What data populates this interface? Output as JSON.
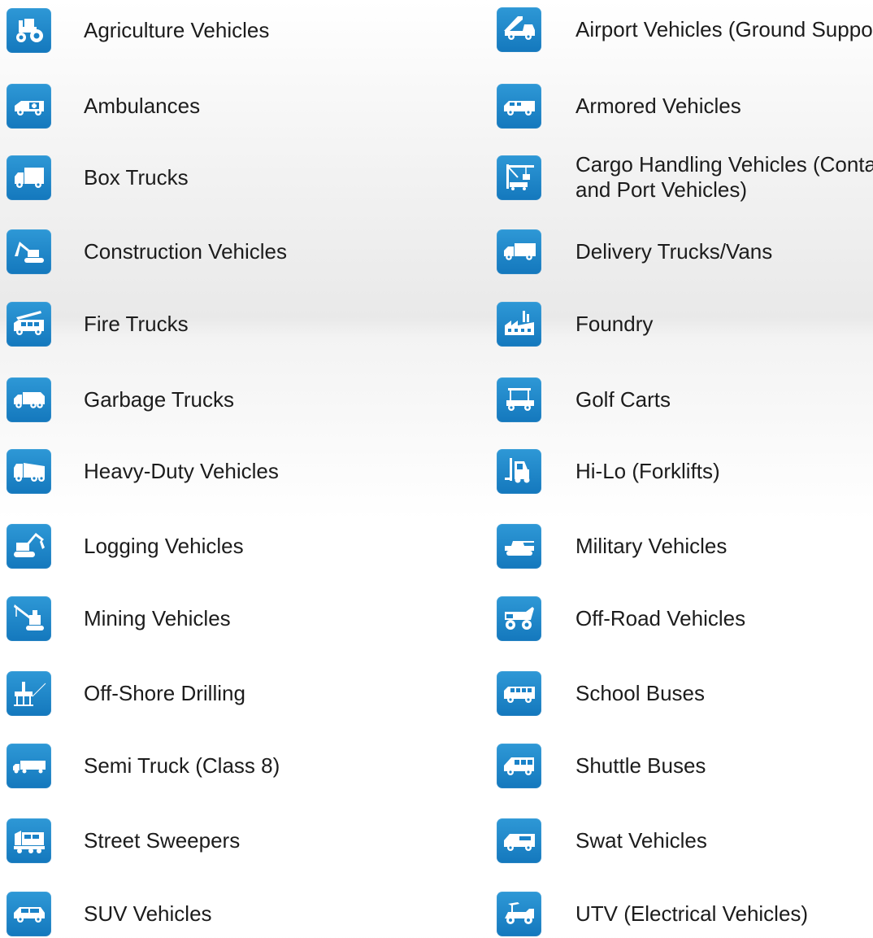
{
  "left": [
    {
      "label": "Agriculture Vehicles",
      "icon": "tractor-icon"
    },
    {
      "label": "Ambulances",
      "icon": "ambulance-icon"
    },
    {
      "label": "Box Trucks",
      "icon": "box-truck-icon"
    },
    {
      "label": "Construction Vehicles",
      "icon": "excavator-icon"
    },
    {
      "label": "Fire Trucks",
      "icon": "fire-truck-icon"
    },
    {
      "label": "Garbage Trucks",
      "icon": "garbage-truck-icon"
    },
    {
      "label": "Heavy-Duty Vehicles",
      "icon": "heavy-truck-icon"
    },
    {
      "label": "Logging Vehicles",
      "icon": "logging-vehicle-icon"
    },
    {
      "label": "Mining Vehicles",
      "icon": "mining-crane-icon"
    },
    {
      "label": "Off-Shore Drilling",
      "icon": "oil-rig-icon"
    },
    {
      "label": "Semi Truck (Class 8)",
      "icon": "semi-truck-icon"
    },
    {
      "label": "Street Sweepers",
      "icon": "street-sweeper-icon"
    },
    {
      "label": "SUV Vehicles",
      "icon": "suv-icon"
    }
  ],
  "right": [
    {
      "label": "Airport Vehicles (Ground Support)",
      "icon": "airport-stairs-truck-icon"
    },
    {
      "label": "Armored Vehicles",
      "icon": "armored-van-icon"
    },
    {
      "label": "Cargo Handling Vehicles (Container and Port Vehicles)",
      "icon": "port-crane-icon"
    },
    {
      "label": "Delivery Trucks/Vans",
      "icon": "delivery-truck-icon"
    },
    {
      "label": "Foundry",
      "icon": "factory-icon"
    },
    {
      "label": "Golf Carts",
      "icon": "golf-cart-icon"
    },
    {
      "label": "Hi-Lo (Forklifts)",
      "icon": "forklift-icon"
    },
    {
      "label": "Military Vehicles",
      "icon": "tank-icon"
    },
    {
      "label": "Off-Road Vehicles",
      "icon": "dump-truck-icon"
    },
    {
      "label": "School Buses",
      "icon": "school-bus-icon"
    },
    {
      "label": "Shuttle Buses",
      "icon": "shuttle-bus-icon"
    },
    {
      "label": "Swat Vehicles",
      "icon": "swat-van-icon"
    },
    {
      "label": "UTV (Electrical Vehicles)",
      "icon": "utv-icon"
    }
  ],
  "colors": {
    "icon_tile": "#1a82c8",
    "icon_glyph": "#ffffff",
    "text": "#1c1c1c"
  }
}
